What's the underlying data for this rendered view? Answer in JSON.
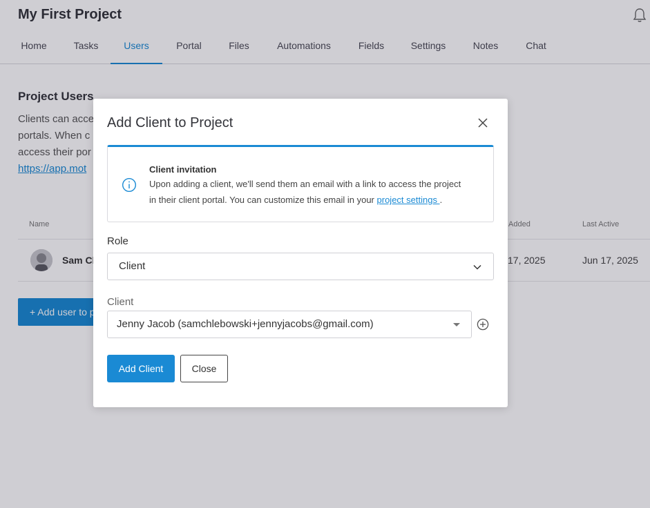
{
  "header": {
    "project_title": "My First Project",
    "bell_icon": "bell-icon"
  },
  "tabs": [
    {
      "label": "Home"
    },
    {
      "label": "Tasks"
    },
    {
      "label": "Users",
      "active": true
    },
    {
      "label": "Portal"
    },
    {
      "label": "Files"
    },
    {
      "label": "Automations"
    },
    {
      "label": "Fields"
    },
    {
      "label": "Settings"
    },
    {
      "label": "Notes"
    },
    {
      "label": "Chat"
    }
  ],
  "users_section": {
    "title": "Project Users",
    "description_lines": [
      "Clients can acce",
      "portals. When c",
      "access their por"
    ],
    "link": "https://app.mot",
    "columns": {
      "name": "Name",
      "added": "Added",
      "last_active": "Last Active"
    },
    "row": {
      "name": "Sam Ch",
      "added": "17, 2025",
      "last_active": "Jun 17, 2025"
    },
    "add_user_button": "+ Add user to p"
  },
  "modal": {
    "title": "Add Client to Project",
    "close_icon": "close-icon",
    "info": {
      "icon": "info-icon",
      "title": "Client invitation",
      "line1": "Upon adding a client, we'll send them an email with a link to access the project",
      "line2_prefix": "in their client portal. You can customize this email in your ",
      "link": "project settings ",
      "line2_suffix": "."
    },
    "role": {
      "label": "Role",
      "value": "Client"
    },
    "client": {
      "label": "Client",
      "value": "Jenny Jacob (samchlebowski+jennyjacobs@gmail.com)"
    },
    "add_button": "Add Client",
    "close_button": "Close"
  },
  "colors": {
    "accent": "#1a8ad4",
    "overlay": "rgba(15,12,35,0.2)"
  }
}
